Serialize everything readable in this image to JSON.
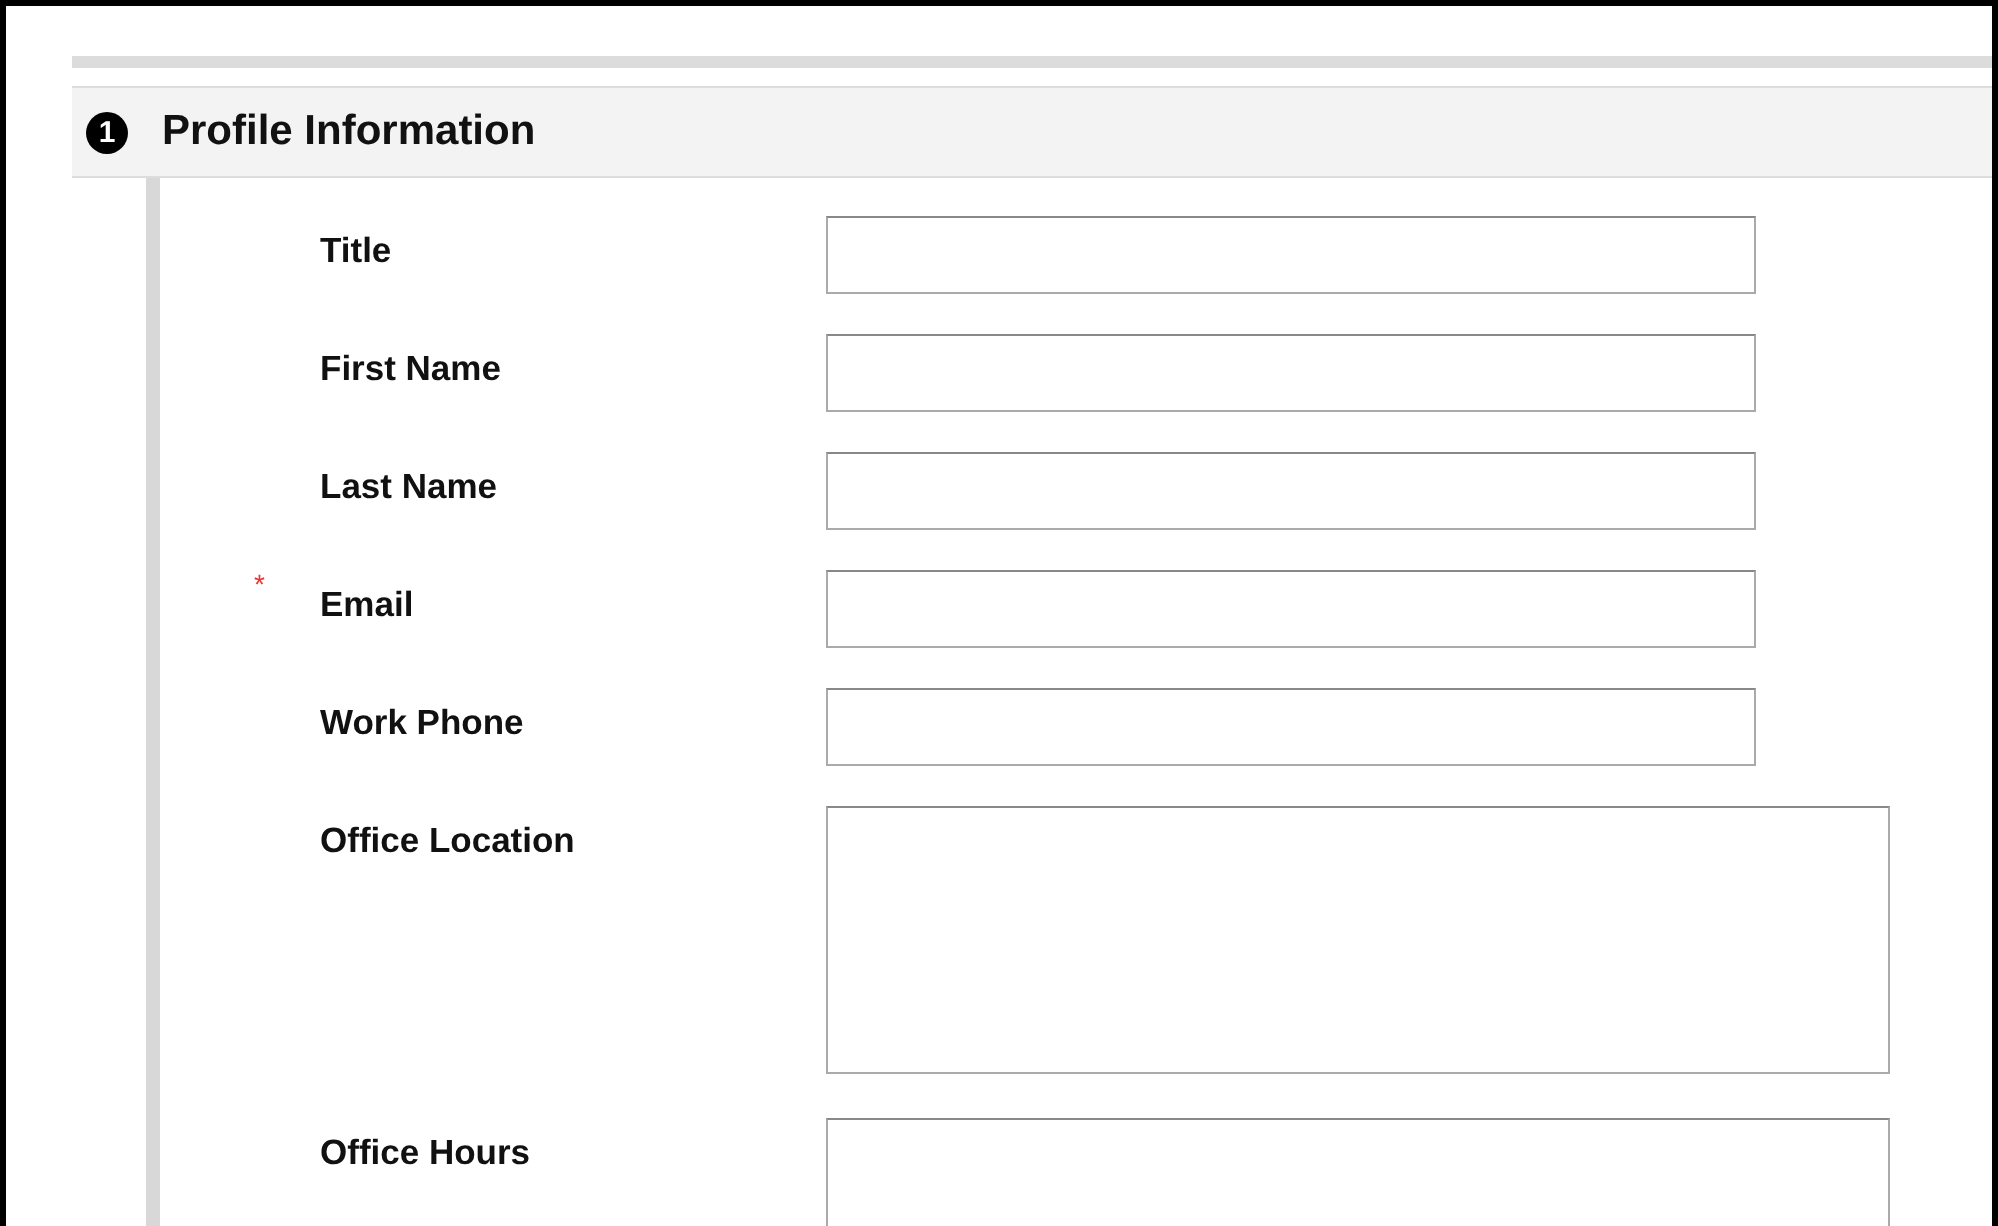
{
  "section": {
    "step_number": "1",
    "title": "Profile Information"
  },
  "fields": [
    {
      "label": "Title",
      "kind": "input"
    },
    {
      "label": "First Name",
      "kind": "input"
    },
    {
      "label": "Last Name",
      "kind": "input"
    },
    {
      "label": "Email",
      "kind": "input",
      "required_mark": "*"
    },
    {
      "label": "Work Phone",
      "kind": "input"
    },
    {
      "label": "Office Location",
      "kind": "textarea"
    },
    {
      "label": "Office Hours",
      "kind": "textarea"
    }
  ]
}
